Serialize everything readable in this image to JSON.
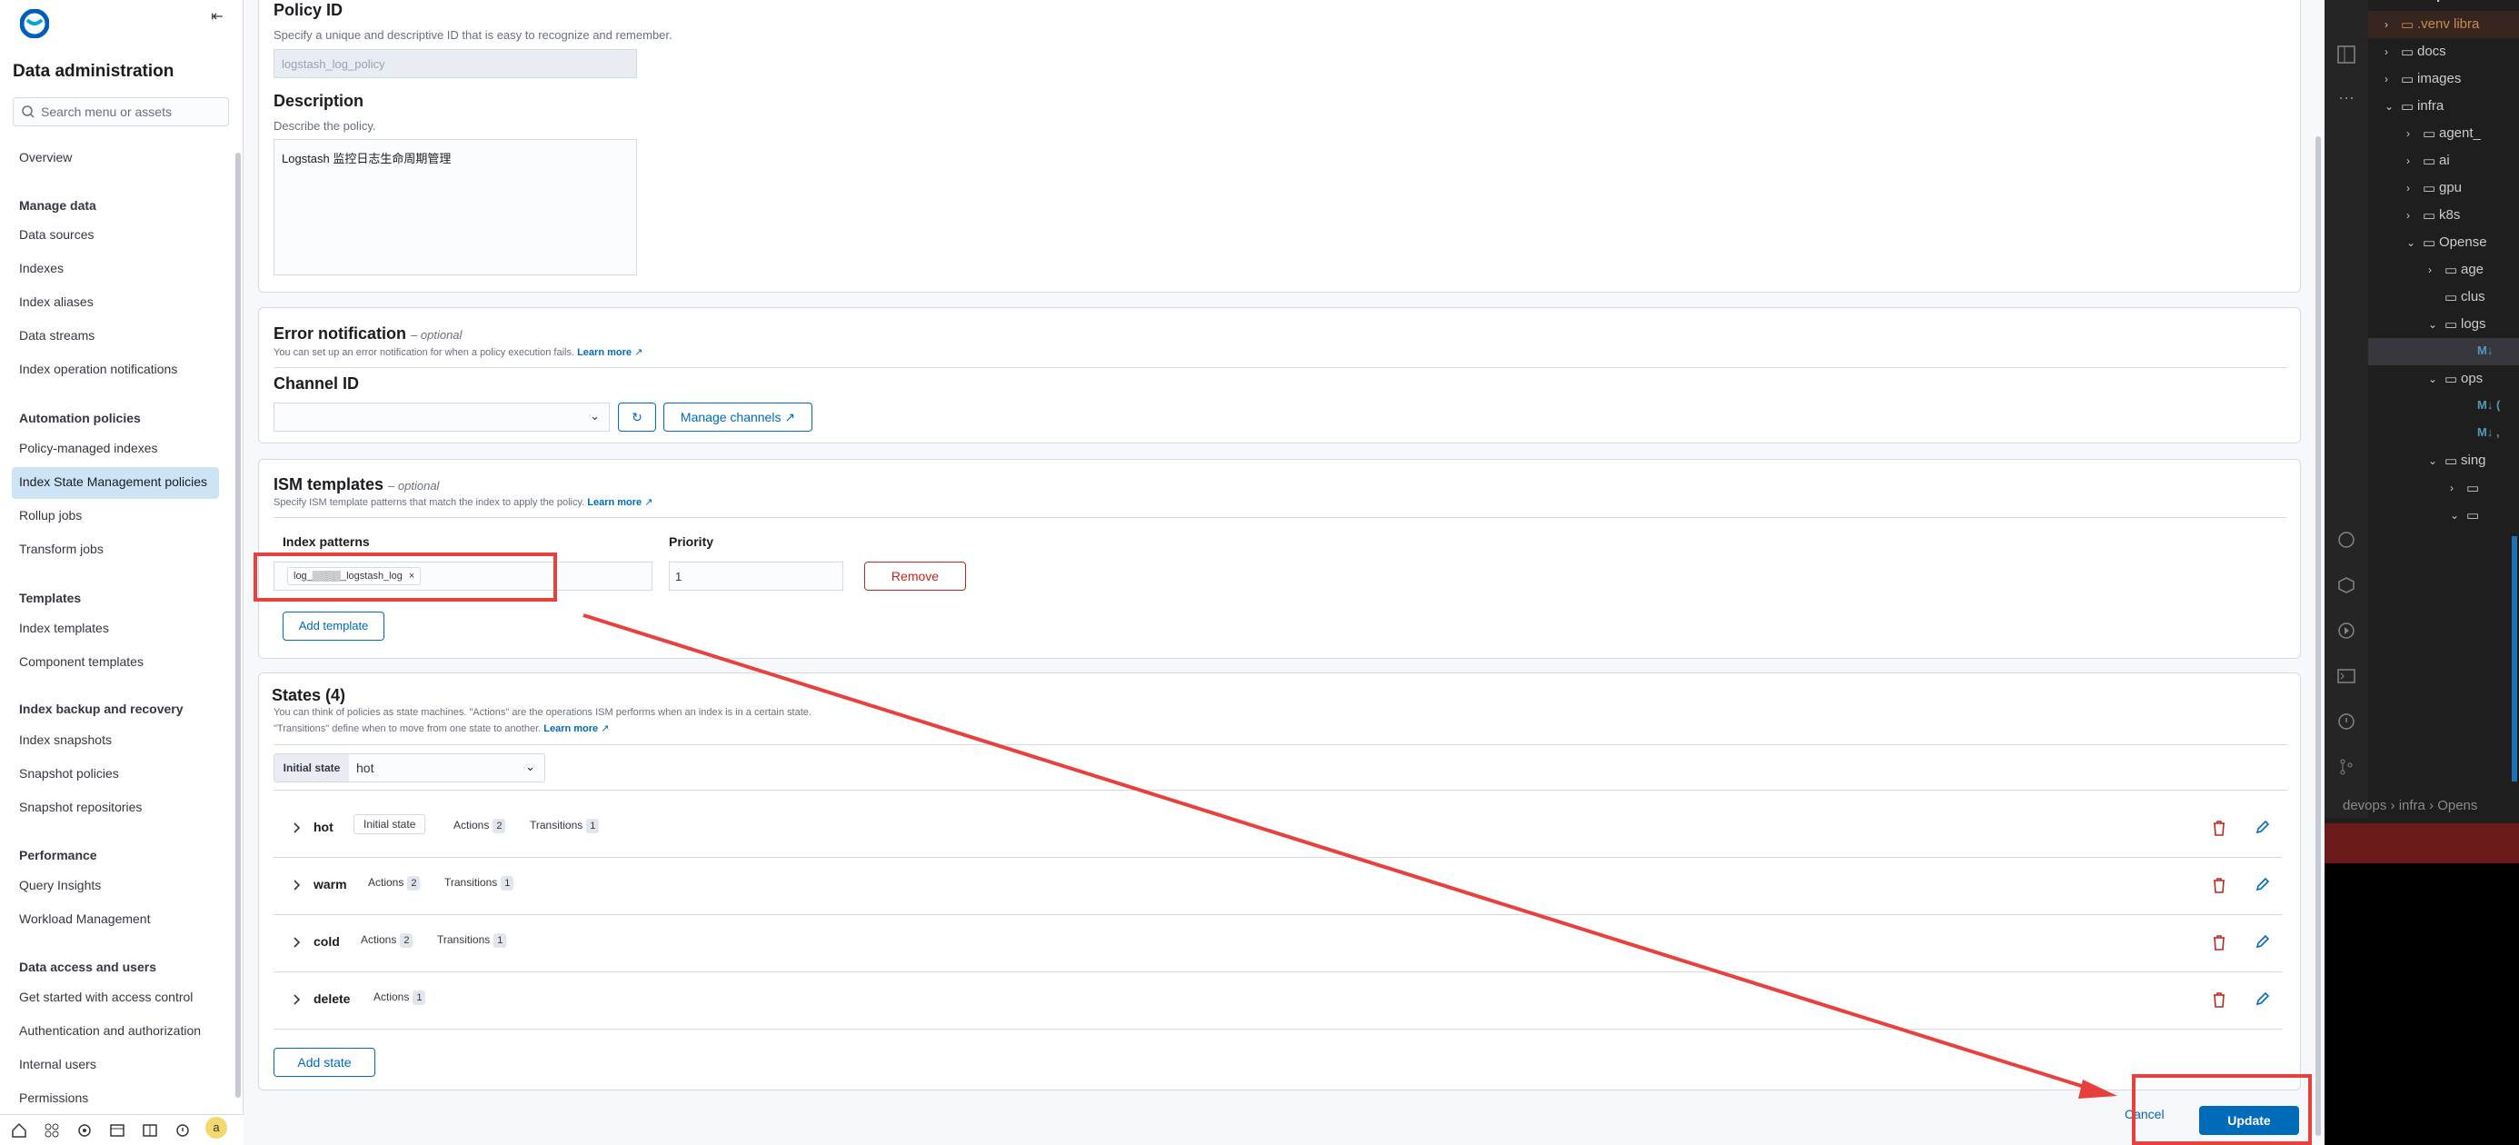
{
  "sidebar": {
    "title": "Data administration",
    "search_placeholder": "Search menu or assets",
    "overview": "Overview",
    "sections": {
      "manage_data": "Manage data",
      "automation": "Automation policies",
      "templates": "Templates",
      "backup": "Index backup and recovery",
      "performance": "Performance",
      "access": "Data access and users"
    },
    "items": {
      "data_sources": "Data sources",
      "indexes": "Indexes",
      "index_aliases": "Index aliases",
      "data_streams": "Data streams",
      "index_op_notifications": "Index operation notifications",
      "policy_managed": "Policy-managed indexes",
      "ism_policies": "Index State Management policies",
      "rollup": "Rollup jobs",
      "transform": "Transform jobs",
      "index_templates": "Index templates",
      "component_templates": "Component templates",
      "index_snapshots": "Index snapshots",
      "snapshot_policies": "Snapshot policies",
      "snapshot_repos": "Snapshot repositories",
      "query_insights": "Query Insights",
      "workload_mgmt": "Workload Management",
      "get_started_access": "Get started with access control",
      "authn_authz": "Authentication and authorization",
      "internal_users": "Internal users",
      "permissions": "Permissions"
    },
    "avatar_letter": "a"
  },
  "policy": {
    "id_label": "Policy ID",
    "id_help": "Specify a unique and descriptive ID that is easy to recognize and remember.",
    "id_value": "logstash_log_policy",
    "desc_label": "Description",
    "desc_help": "Describe the policy.",
    "desc_value": "Logstash 监控日志生命周期管理"
  },
  "error_notification": {
    "title": "Error notification",
    "optional": "– optional",
    "help": "You can set up an error notification for when a policy execution fails.",
    "learn_more": "Learn more",
    "channel_label": "Channel ID",
    "channel_value": "",
    "manage_channels": "Manage channels"
  },
  "ism_templates": {
    "title": "ISM templates",
    "optional": "– optional",
    "help": "Specify ISM template patterns that match the index to apply the policy.",
    "learn_more": "Learn more",
    "index_patterns_label": "Index patterns",
    "priority_label": "Priority",
    "pattern_chip": "log_▒▒▒▒_logstash_log",
    "priority_value": "1",
    "remove": "Remove",
    "add_template": "Add template"
  },
  "states": {
    "title": "States (4)",
    "help1": "You can think of policies as state machines. \"Actions\" are the operations ISM performs when an index is in a certain state.",
    "help2": "\"Transitions\" define when to move from one state to another.",
    "learn_more": "Learn more",
    "initial_state_label": "Initial state",
    "initial_state_value": "hot",
    "initial_badge": "Initial state",
    "actions_label": "Actions",
    "transitions_label": "Transitions",
    "rows": [
      {
        "name": "hot",
        "actions": "2",
        "transitions": "1"
      },
      {
        "name": "warm",
        "actions": "2",
        "transitions": "1"
      },
      {
        "name": "cold",
        "actions": "2",
        "transitions": "1"
      },
      {
        "name": "delete",
        "actions": "1"
      }
    ],
    "add_state": "Add state"
  },
  "footer": {
    "cancel": "Cancel",
    "update": "Update"
  },
  "editor": {
    "tree": [
      {
        "label": "devops",
        "kind": "folder"
      },
      {
        "label": ".venv libra",
        "kind": "folder"
      },
      {
        "label": "docs",
        "kind": "folder"
      },
      {
        "label": "images",
        "kind": "folder"
      },
      {
        "label": "infra",
        "kind": "folder"
      },
      {
        "label": "agent_",
        "kind": "folder"
      },
      {
        "label": "ai",
        "kind": "folder"
      },
      {
        "label": "gpu",
        "kind": "folder"
      },
      {
        "label": "k8s",
        "kind": "folder"
      },
      {
        "label": "Opense",
        "kind": "folder"
      },
      {
        "label": "age",
        "kind": "folder"
      },
      {
        "label": "clus",
        "kind": "folder"
      },
      {
        "label": "logs",
        "kind": "folder"
      },
      {
        "label": "M↓",
        "kind": "md"
      },
      {
        "label": "ops",
        "kind": "folder"
      },
      {
        "label": "M↓ (",
        "kind": "md"
      },
      {
        "label": "M↓ ,",
        "kind": "md"
      },
      {
        "label": "sing",
        "kind": "folder"
      }
    ],
    "breadcrumb": "devops › infra › Opens"
  },
  "colors": {
    "accent": "#006bb8",
    "danger": "#bd271e",
    "annotation": "#e8403c",
    "active_nav": "#cce4f5"
  }
}
